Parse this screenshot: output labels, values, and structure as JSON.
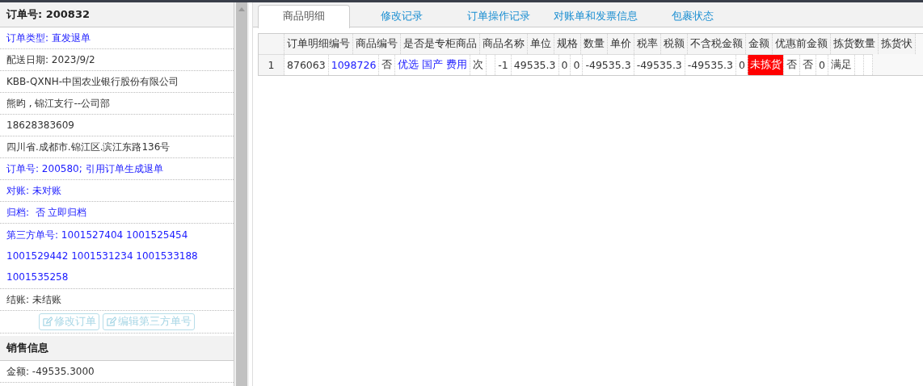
{
  "order_panel": {
    "title": "订单号: 200832",
    "rows": [
      {
        "text": "订单类型: 直发退单",
        "kind": "link"
      },
      {
        "text": "配送日期: 2023/9/2",
        "kind": "text"
      },
      {
        "text": "KBB-QXNH-中国农业银行股份有限公司",
        "kind": "text"
      },
      {
        "text": "熊昀 , 锦江支行--公司部",
        "kind": "text"
      },
      {
        "text": "18628383609",
        "kind": "text"
      },
      {
        "text": "四川省.成都市.锦江区.滨江东路136号",
        "kind": "text"
      },
      {
        "text": "订单号: 200580; 引用订单生成退单",
        "kind": "link"
      },
      {
        "text": "对账: 未对账",
        "kind": "link"
      },
      {
        "text": "归档:  否 立即归档",
        "kind": "link"
      },
      {
        "text": "第三方单号: 1001527404 1001525454 1001529442 1001531234 1001533188 1001535258",
        "kind": "link"
      },
      {
        "text": "结账: 未结账",
        "kind": "text"
      }
    ],
    "buttons": [
      {
        "label": "修改订单",
        "disabled": true
      },
      {
        "label": "编辑第三方单号",
        "disabled": true
      }
    ]
  },
  "sales_panel": {
    "title": "销售信息",
    "rows": [
      {
        "text": "金额: -49535.3000"
      }
    ]
  },
  "tabs": [
    {
      "label": "商品明细",
      "selected": true
    },
    {
      "label": "修改记录",
      "selected": false
    },
    {
      "label": "订单操作记录",
      "selected": false
    },
    {
      "label": "对账单和发票信息",
      "selected": false
    },
    {
      "label": "包裹状态",
      "selected": false
    }
  ],
  "table": {
    "header_cells": [
      "订单明细编号",
      "商品编号",
      "是否是专柜商品",
      "商品名称",
      "单位",
      "规格",
      "数量",
      "单价",
      "税率",
      "税额",
      "不含税金额",
      "金额",
      "优惠前金额",
      "拣货数量",
      "拣货状"
    ],
    "data_rows": [
      {
        "number": "1",
        "cells": [
          {
            "text": "876063",
            "kind": "text"
          },
          {
            "text": "1098726",
            "kind": "link"
          },
          {
            "text": "否",
            "kind": "text"
          },
          {
            "text": "优选 国产 费用",
            "kind": "link"
          },
          {
            "text": "次",
            "kind": "text"
          },
          {
            "kind": "empty"
          },
          {
            "text": "-1",
            "kind": "text"
          },
          {
            "text": "49535.3",
            "kind": "text"
          },
          {
            "text": "0",
            "kind": "text"
          },
          {
            "text": "0",
            "kind": "text"
          },
          {
            "text": "-49535.3",
            "kind": "text"
          },
          {
            "text": "-49535.3",
            "kind": "text"
          },
          {
            "text": "-49535.3",
            "kind": "text"
          },
          {
            "text": "0",
            "kind": "text"
          },
          {
            "text": "未拣货",
            "kind": "alert"
          },
          {
            "text": "否",
            "kind": "text"
          },
          {
            "text": "否",
            "kind": "text"
          },
          {
            "text": "0",
            "kind": "text"
          },
          {
            "text": "满足",
            "kind": "text"
          },
          {
            "kind": "empty"
          },
          {
            "kind": "empty"
          }
        ]
      }
    ]
  }
}
